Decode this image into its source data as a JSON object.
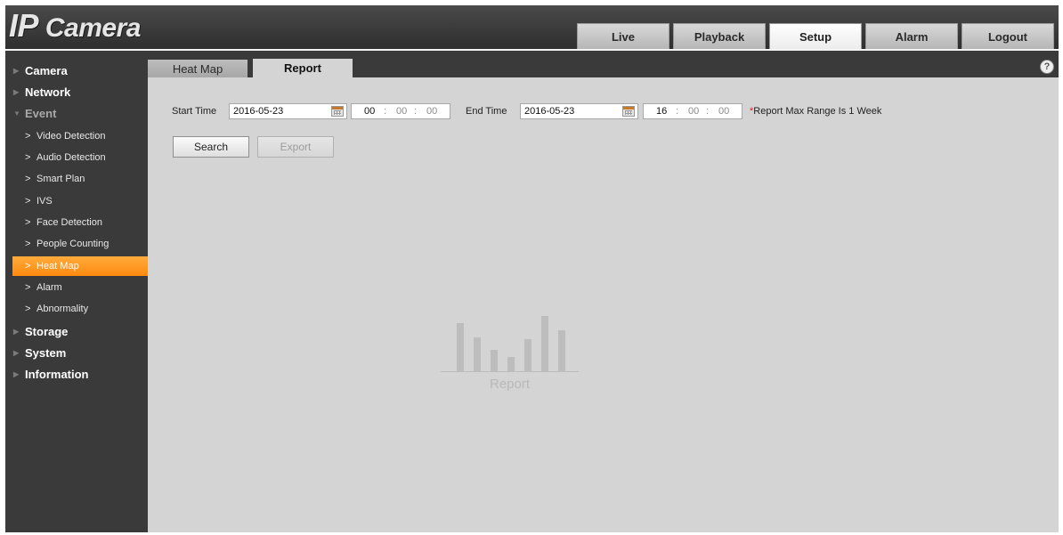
{
  "app": {
    "logo_prefix": "IP",
    "logo_suffix": "Camera"
  },
  "topnav": {
    "live": "Live",
    "playback": "Playback",
    "setup": "Setup",
    "alarm": "Alarm",
    "logout": "Logout",
    "active": "Setup"
  },
  "sidebar": {
    "camera": "Camera",
    "network": "Network",
    "event": "Event",
    "event_items": {
      "video_detection": "Video Detection",
      "audio_detection": "Audio Detection",
      "smart_plan": "Smart Plan",
      "ivs": "IVS",
      "face_detection": "Face Detection",
      "people_counting": "People Counting",
      "heat_map": "Heat Map",
      "alarm": "Alarm",
      "abnormality": "Abnormality"
    },
    "storage": "Storage",
    "system": "System",
    "information": "Information",
    "active_item": "Heat Map"
  },
  "tabs": {
    "heat_map": "Heat Map",
    "report": "Report",
    "active": "Report"
  },
  "form": {
    "start_label": "Start Time",
    "start_date": "2016-05-23",
    "start_hour": "00",
    "start_min": "00",
    "start_sec": "00",
    "end_label": "End Time",
    "end_date": "2016-05-23",
    "end_hour": "16",
    "end_min": "00",
    "end_sec": "00",
    "note_star": "*",
    "note_text": "Report Max Range Is 1 Week",
    "search_label": "Search",
    "export_label": "Export"
  },
  "placeholder": {
    "caption": "Report"
  },
  "colors": {
    "accent": "#ff9a22",
    "sidebar_bg": "#3a3a3a",
    "content_bg": "#d4d4d4"
  }
}
